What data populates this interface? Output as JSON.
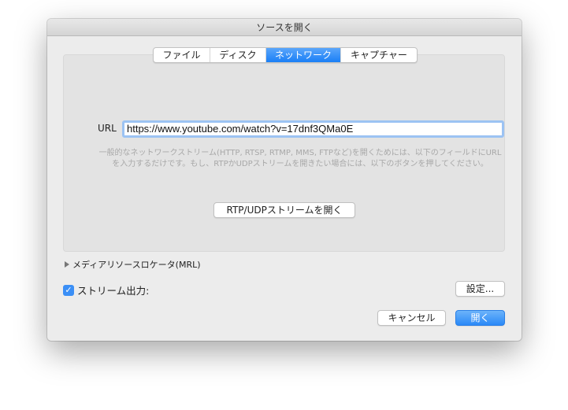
{
  "window": {
    "title": "ソースを開く"
  },
  "tabs": [
    {
      "label": "ファイル"
    },
    {
      "label": "ディスク"
    },
    {
      "label": "ネットワーク",
      "active": true
    },
    {
      "label": "キャプチャー"
    }
  ],
  "network": {
    "url_label": "URL",
    "url_value": "https://www.youtube.com/watch?v=17dnf3QMa0E",
    "help_text": "一般的なネットワークストリーム(HTTP, RTSP, RTMP, MMS, FTPなど)を開くためには、以下のフィールドにURLを入力するだけです。もし、RTPかUDPストリームを開きたい場合には、以下のボタンを押してください。",
    "rtp_button": "RTP/UDPストリームを開く"
  },
  "mrl": {
    "label": "メディアリソースロケータ(MRL)"
  },
  "stream_output": {
    "label": "ストリーム出力:",
    "checked": true,
    "settings_button": "設定..."
  },
  "footer": {
    "cancel": "キャンセル",
    "open": "開く"
  }
}
